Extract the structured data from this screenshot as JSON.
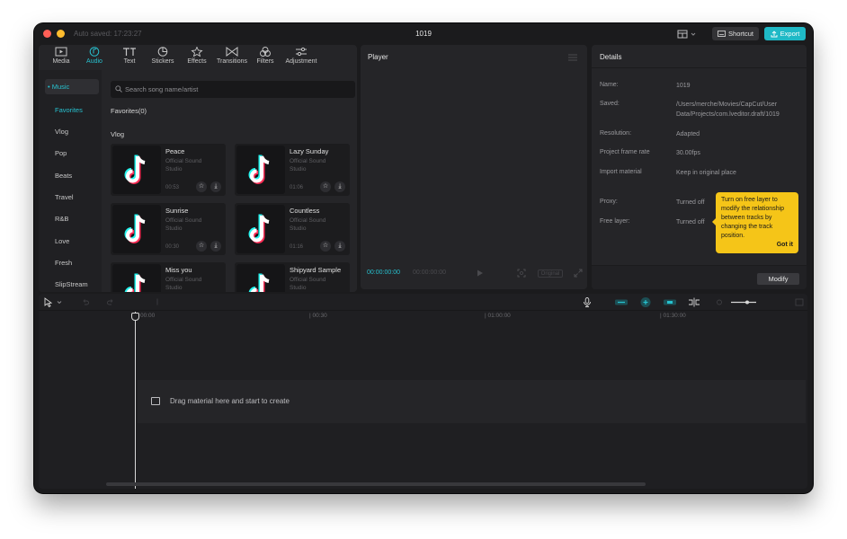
{
  "window": {
    "autosave": "Auto saved: 17:23:27",
    "title": "1019"
  },
  "topbar": {
    "shortcut_label": "Shortcut",
    "export_label": "Export"
  },
  "toolbar": {
    "tabs": [
      {
        "label": "Media",
        "icon": "media-icon"
      },
      {
        "label": "Audio",
        "icon": "audio-icon",
        "active": true
      },
      {
        "label": "Text",
        "icon": "text-icon"
      },
      {
        "label": "Stickers",
        "icon": "stickers-icon"
      },
      {
        "label": "Effects",
        "icon": "effects-icon"
      },
      {
        "label": "Transitions",
        "icon": "transitions-icon"
      },
      {
        "label": "Filters",
        "icon": "filters-icon"
      },
      {
        "label": "Adjustment",
        "icon": "adjustment-icon"
      }
    ]
  },
  "sidebar": {
    "header": "• Music",
    "items": [
      {
        "label": "Favorites",
        "selected": true
      },
      {
        "label": "Vlog"
      },
      {
        "label": "Pop"
      },
      {
        "label": "Beats"
      },
      {
        "label": "Travel"
      },
      {
        "label": "R&B"
      },
      {
        "label": "Love"
      },
      {
        "label": "Fresh"
      },
      {
        "label": "SlipStream"
      }
    ]
  },
  "search": {
    "placeholder": "Search song name/artist"
  },
  "library": {
    "favorites_label": "Favorites(0)",
    "vlog_label": "Vlog",
    "songs": [
      {
        "title": "Peace",
        "artist": "Official Sound Studio",
        "duration": "00:53"
      },
      {
        "title": "Lazy Sunday",
        "artist": "Official Sound Studio",
        "duration": "01:06"
      },
      {
        "title": "Sunrise",
        "artist": "Official Sound Studio",
        "duration": "00:30"
      },
      {
        "title": "Countless",
        "artist": "Official Sound Studio",
        "duration": "01:16"
      },
      {
        "title": "Miss  you",
        "artist": "Official Sound Studio",
        "duration": ""
      },
      {
        "title": "Shipyard Sample",
        "artist": "Official Sound Studio",
        "duration": ""
      }
    ]
  },
  "player": {
    "title": "Player",
    "current_time": "00:00:00:00",
    "total_time": "00:00:00:00",
    "ratio_label": "Original"
  },
  "details": {
    "title": "Details",
    "rows": [
      {
        "label": "Name:",
        "value": "1019"
      },
      {
        "label": "Saved:",
        "value": "/Users/merche/Movies/CapCut/User Data/Projects/com.lveditor.draft/1019"
      },
      {
        "label": "Resolution:",
        "value": "Adapted"
      },
      {
        "label": "Project frame rate",
        "value": "30.00fps"
      },
      {
        "label": "Import material",
        "value": "Keep in original place"
      },
      {
        "label": "Proxy:",
        "value": "Turned off"
      },
      {
        "label": "Free layer:",
        "value": "Turned off"
      }
    ],
    "modify_label": "Modify"
  },
  "tooltip": {
    "text": "Turn on free layer to modify the relationship between tracks by changing the track position.",
    "button": "Got it"
  },
  "timeline": {
    "ruler": [
      "00:00",
      "| 00:30",
      "| 01:00:00",
      "| 01:30:00"
    ],
    "drop_hint": "Drag material here and start to create"
  }
}
